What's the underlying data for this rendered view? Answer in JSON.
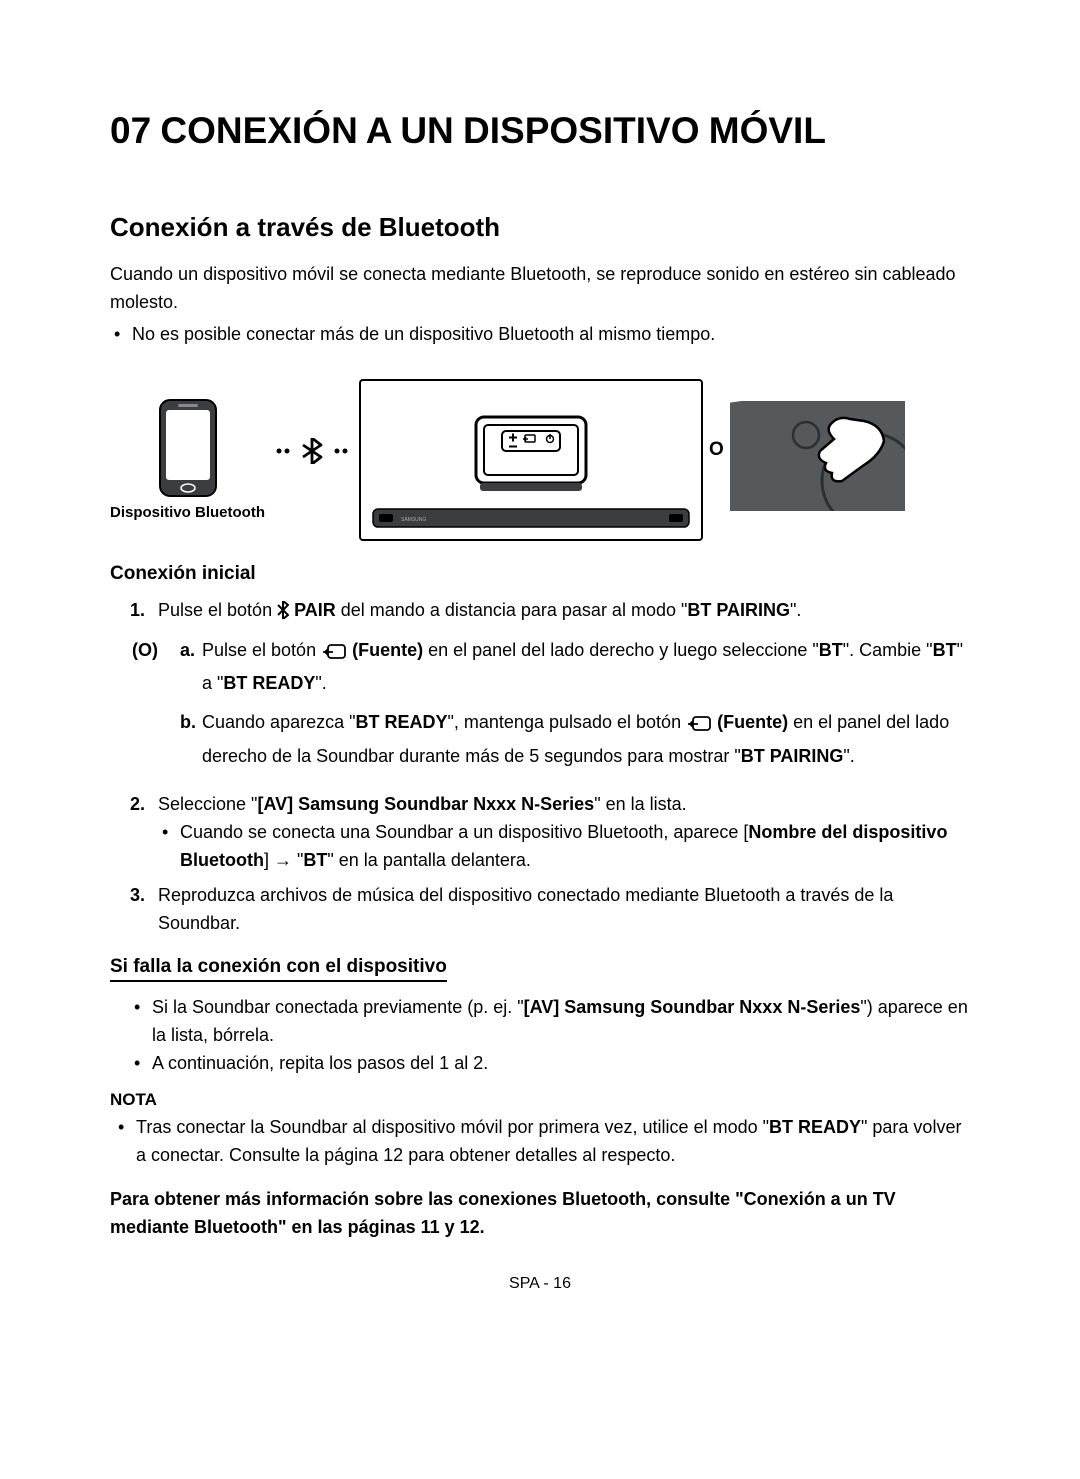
{
  "title": "07 CONEXIÓN A UN DISPOSITIVO MÓVIL",
  "heading": "Conexión a través de Bluetooth",
  "intro": "Cuando un dispositivo móvil se conecta mediante Bluetooth, se reproduce sonido en estéreo sin cableado molesto.",
  "intro_bullet": "No es posible conectar más de un dispositivo Bluetooth al mismo tiempo.",
  "device_label": "Dispositivo Bluetooth",
  "or_letter": "O",
  "initial": {
    "heading": "Conexión inicial",
    "step1_a": "Pulse el botón ",
    "step1_pair": " PAIR",
    "step1_b": " del mando a distancia para pasar al modo \"",
    "step1_bt": "BT PAIRING",
    "step1_c": "\".",
    "or_label": "(O)",
    "a_letter": "a.",
    "a_text_1": "Pulse el botón ",
    "a_fuente": " (Fuente)",
    "a_text_2": " en el panel del lado derecho y luego seleccione \"",
    "a_bt": "BT",
    "a_text_3": "\". Cambie \"",
    "a_bt2": "BT",
    "a_text_4": "\" a \"",
    "a_btready": "BT READY",
    "a_text_5": "\".",
    "b_letter": "b.",
    "b_text_1": "Cuando aparezca \"",
    "b_btready": "BT READY",
    "b_text_2": "\", mantenga pulsado el botón ",
    "b_fuente": " (Fuente)",
    "b_text_3": " en el panel del lado derecho de la Soundbar durante más de 5 segundos para mostrar \"",
    "b_btpair": "BT PAIRING",
    "b_text_4": "\".",
    "step2_a": "Seleccione \"",
    "step2_bold": "[AV] Samsung Soundbar Nxxx N-Series",
    "step2_b": "\" en la lista.",
    "step2_bullet_a": "Cuando se conecta una Soundbar a un dispositivo Bluetooth, aparece [",
    "step2_bullet_bold": "Nombre del dispositivo Bluetooth",
    "step2_bullet_b": "] → \"",
    "step2_bullet_bt": "BT",
    "step2_bullet_c": "\" en la pantalla delantera.",
    "step3": "Reproduzca archivos de música del dispositivo conectado mediante Bluetooth a través de la Soundbar."
  },
  "fail": {
    "heading": "Si falla la conexión con el dispositivo",
    "b1_a": "Si la Soundbar conectada previamente (p. ej. \"",
    "b1_bold": "[AV] Samsung Soundbar Nxxx N-Series",
    "b1_b": "\") aparece en la lista, bórrela.",
    "b2": "A continuación, repita los pasos del 1 al 2."
  },
  "nota_label": "NOTA",
  "nota_a": "Tras conectar la Soundbar al dispositivo móvil por primera vez, utilice el modo \"",
  "nota_bold": "BT READY",
  "nota_b": "\" para volver a conectar. Consulte la página 12 para obtener detalles al respecto.",
  "final": "Para obtener más información sobre las conexiones Bluetooth, consulte \"Conexión a un TV mediante Bluetooth\" en las páginas 11 y 12.",
  "footer": "SPA - 16"
}
